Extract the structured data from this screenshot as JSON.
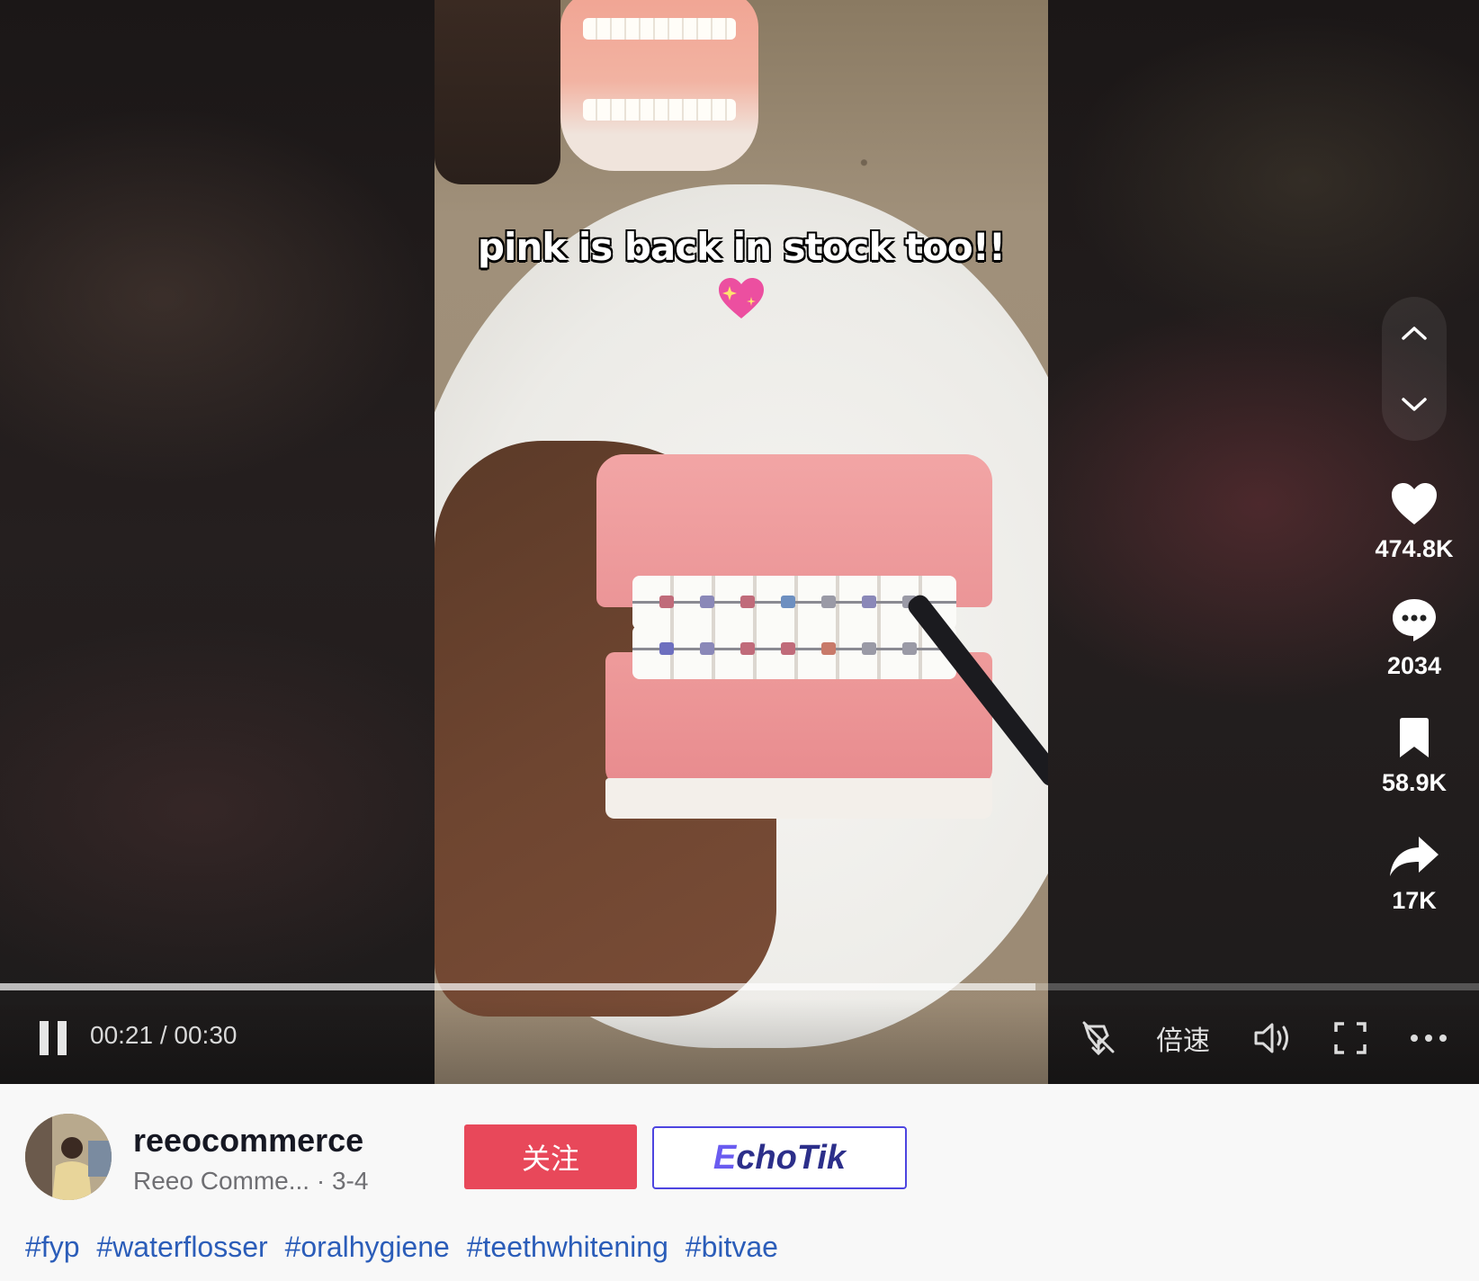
{
  "video": {
    "caption": "pink is back in stock too!!",
    "caption_emoji": "sparkling-heart"
  },
  "actions": {
    "likes": "474.8K",
    "comments": "2034",
    "saves": "58.9K",
    "shares": "17K"
  },
  "controls": {
    "time": "00:21 / 00:30",
    "speed_label": "倍速",
    "progress": 0.7
  },
  "author": {
    "username": "reeocommerce",
    "display_name": "Reeo Comme...",
    "date": " · 3-4",
    "follow_label": "关注",
    "echotik_label_e": "E",
    "echotik_label_rest": "choTik"
  },
  "hashtags": [
    "#fyp",
    "#waterflosser",
    "#oralhygiene",
    "#teethwhitening",
    "#bitvae"
  ],
  "colors": {
    "follow": "#e8485a",
    "hashtag": "#2b5db9",
    "echotik_border": "#4d45e0"
  }
}
